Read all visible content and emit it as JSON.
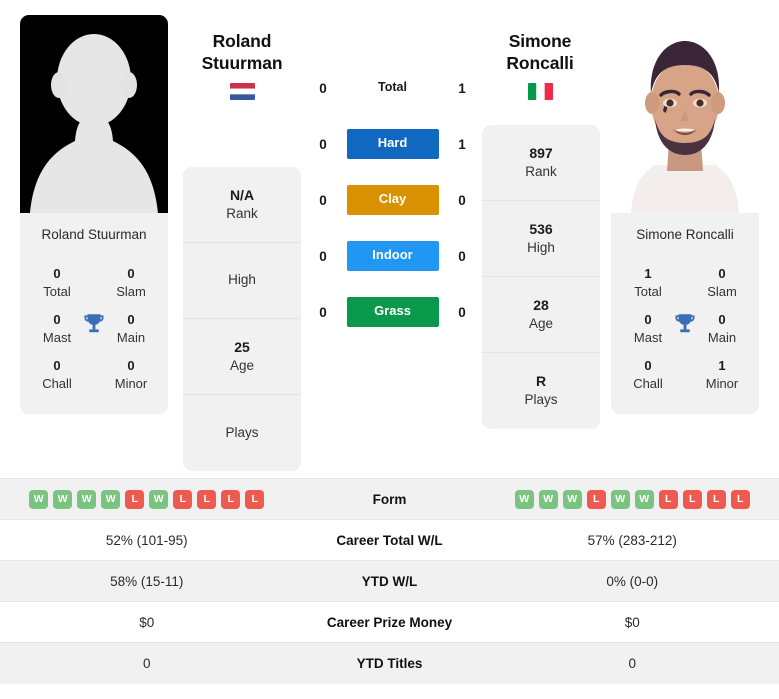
{
  "players": {
    "left": {
      "name": "Roland Stuurman",
      "display_name_line1": "Roland",
      "display_name_line2": "Stuurman",
      "country": "Netherlands",
      "flag_icon": "flag-netherlands-icon",
      "photo_type": "placeholder-avatar-silhouette",
      "titles": {
        "total": "0",
        "total_label": "Total",
        "slam": "0",
        "slam_label": "Slam",
        "mast": "0",
        "mast_label": "Mast",
        "main": "0",
        "main_label": "Main",
        "chall": "0",
        "chall_label": "Chall",
        "minor": "0",
        "minor_label": "Minor"
      },
      "info": [
        {
          "value": "N/A",
          "label": "Rank"
        },
        {
          "value": "",
          "label": "High"
        },
        {
          "value": "25",
          "label": "Age"
        },
        {
          "value": "",
          "label": "Plays"
        }
      ],
      "form": [
        "W",
        "W",
        "W",
        "W",
        "L",
        "W",
        "L",
        "L",
        "L",
        "L"
      ],
      "career_total_wl": "52% (101-95)",
      "ytd_wl": "58% (15-11)",
      "career_prize_money": "$0",
      "ytd_titles": "0",
      "surface_scores": {
        "total": "0",
        "hard": "0",
        "clay": "0",
        "indoor": "0",
        "grass": "0"
      }
    },
    "right": {
      "name": "Simone Roncalli",
      "display_name_line1": "Simone",
      "display_name_line2": "Roncalli",
      "country": "Italy",
      "flag_icon": "flag-italy-icon",
      "photo_type": "player-headshot-photo",
      "titles": {
        "total": "1",
        "total_label": "Total",
        "slam": "0",
        "slam_label": "Slam",
        "mast": "0",
        "mast_label": "Mast",
        "main": "0",
        "main_label": "Main",
        "chall": "0",
        "chall_label": "Chall",
        "minor": "1",
        "minor_label": "Minor"
      },
      "info": [
        {
          "value": "897",
          "label": "Rank"
        },
        {
          "value": "536",
          "label": "High"
        },
        {
          "value": "28",
          "label": "Age"
        },
        {
          "value": "R",
          "label": "Plays"
        }
      ],
      "form": [
        "W",
        "W",
        "W",
        "L",
        "W",
        "W",
        "L",
        "L",
        "L",
        "L"
      ],
      "career_total_wl": "57% (283-212)",
      "ytd_wl": "0% (0-0)",
      "career_prize_money": "$0",
      "ytd_titles": "0",
      "surface_scores": {
        "total": "1",
        "hard": "1",
        "clay": "0",
        "indoor": "0",
        "grass": "0"
      }
    }
  },
  "surfaces": [
    {
      "key": "total",
      "label": "Total",
      "color": "transparent",
      "badge": false
    },
    {
      "key": "hard",
      "label": "Hard",
      "color": "#1068c0",
      "badge": true
    },
    {
      "key": "clay",
      "label": "Clay",
      "color": "#d99100",
      "badge": true
    },
    {
      "key": "indoor",
      "label": "Indoor",
      "color": "#2196f3",
      "badge": true
    },
    {
      "key": "grass",
      "label": "Grass",
      "color": "#089a4a",
      "badge": true
    }
  ],
  "table": {
    "rows": [
      {
        "label": "Form",
        "type": "form"
      },
      {
        "label": "Career Total W/L",
        "type": "text",
        "key": "career_total_wl"
      },
      {
        "label": "YTD W/L",
        "type": "text",
        "key": "ytd_wl"
      },
      {
        "label": "Career Prize Money",
        "type": "text",
        "key": "career_prize_money"
      },
      {
        "label": "YTD Titles",
        "type": "text",
        "key": "ytd_titles"
      }
    ]
  },
  "colors": {
    "form_win": "#7ac47f",
    "form_loss": "#ef5a50",
    "card_bg": "#f1f1f1",
    "trophy": "#3b6fb5"
  }
}
